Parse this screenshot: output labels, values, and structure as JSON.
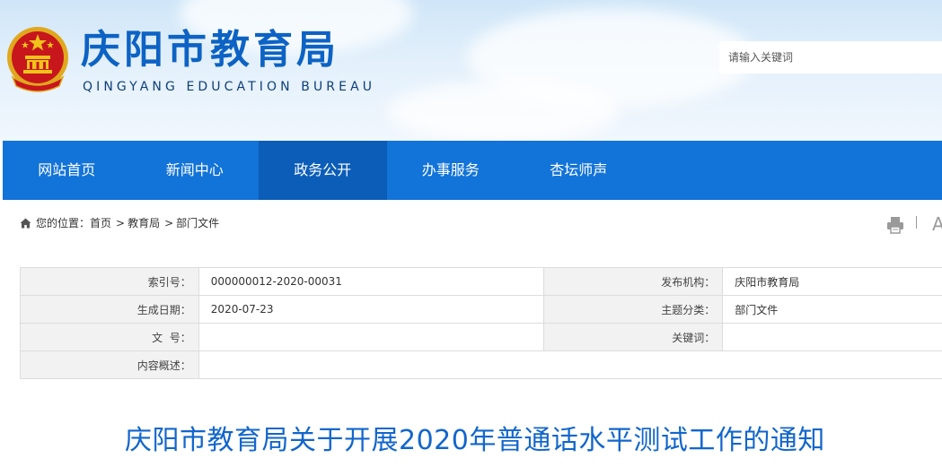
{
  "header": {
    "title": "庆阳市教育局",
    "subtitle": "QINGYANG EDUCATION BUREAU",
    "search_placeholder": "请输入关键词",
    "emblem_icon": "national-emblem-icon"
  },
  "nav": {
    "items": [
      {
        "label": "网站首页",
        "active": false
      },
      {
        "label": "新闻中心",
        "active": false
      },
      {
        "label": "政务公开",
        "active": true
      },
      {
        "label": "办事服务",
        "active": false
      },
      {
        "label": "杏坛师声",
        "active": false
      }
    ]
  },
  "breadcrumb": {
    "prefix": "您的位置：",
    "items": [
      "首页",
      "教育局",
      "部门文件"
    ],
    "separator": ">"
  },
  "tools": {
    "print_icon": "print-icon",
    "font_label": "A"
  },
  "meta": {
    "index_label": "索引号：",
    "index_value": "000000012-2020-00031",
    "publisher_label": "发布机构：",
    "publisher_value": "庆阳市教育局",
    "date_label": "生成日期：",
    "date_value": "2020-07-23",
    "category_label": "主题分类：",
    "category_value": "部门文件",
    "docno_label": "文  号：",
    "docno_value": "",
    "keywords_label": "关键词：",
    "keywords_value": "",
    "summary_label": "内容概述：",
    "summary_value": ""
  },
  "article": {
    "title": "庆阳市教育局关于开展2020年普通话水平测试工作的通知"
  },
  "colors": {
    "brand_blue": "#1273d8",
    "nav_active": "#0b5db8",
    "title_blue": "#1266cc",
    "emblem_red": "#c8161d",
    "emblem_gold": "#f0c419"
  }
}
